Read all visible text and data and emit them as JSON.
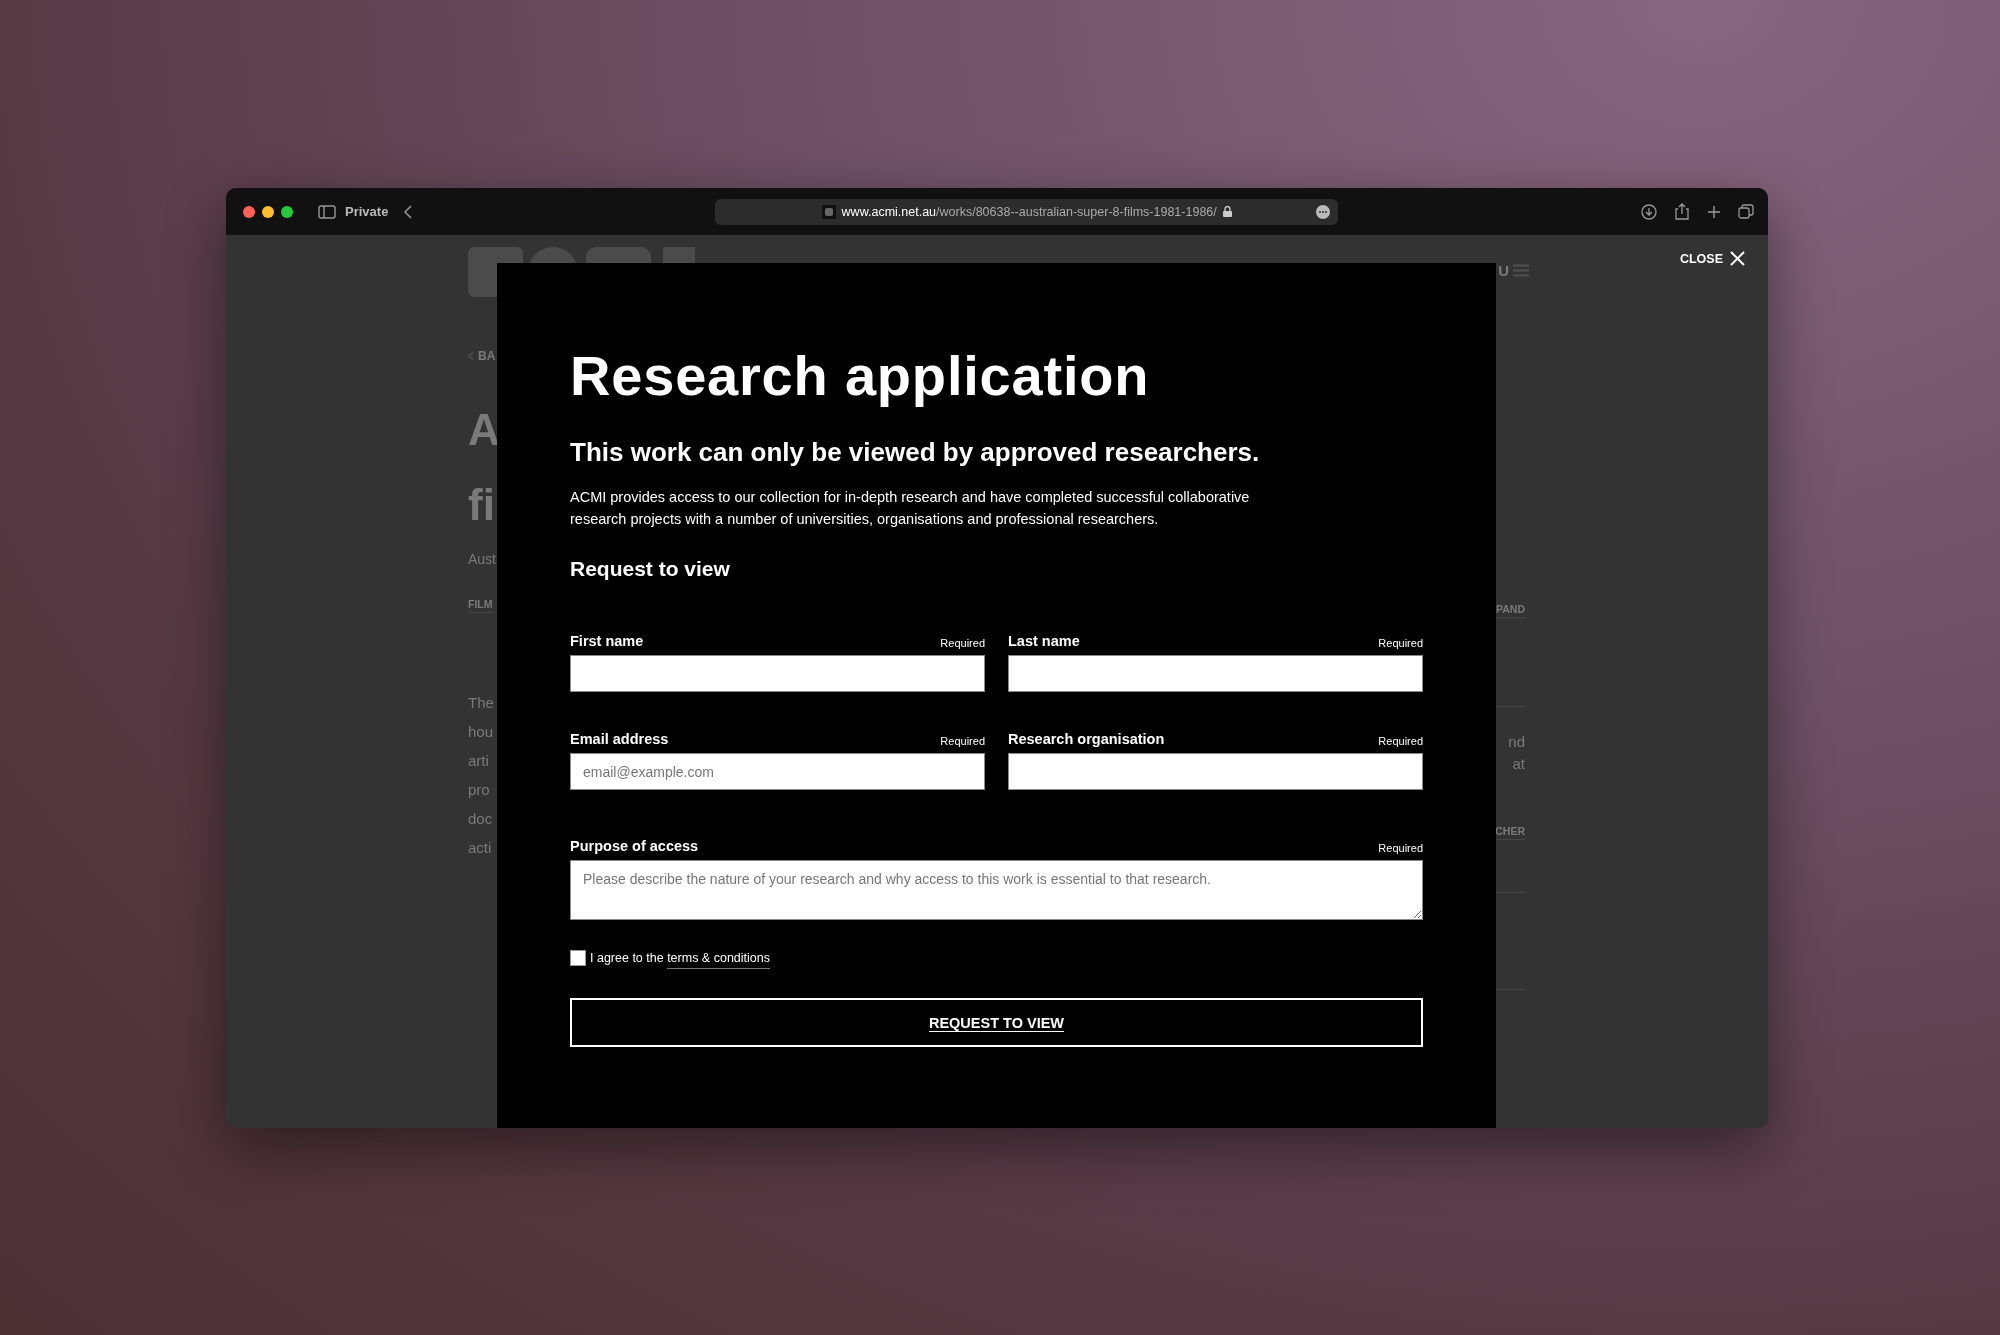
{
  "browser": {
    "mode_label": "Private",
    "url_host": "www.acmi.net.au",
    "url_path": "/works/80638--australian-super-8-films-1981-1986/"
  },
  "background_page": {
    "left_fragments": [
      {
        "kind": "back",
        "text": "BA"
      },
      {
        "kind": "title",
        "text": "A"
      },
      {
        "kind": "title",
        "text": "fi"
      },
      {
        "kind": "meta",
        "text": "Aust"
      },
      {
        "kind": "tag",
        "text": "FILM"
      },
      {
        "kind": "body",
        "text": "The"
      },
      {
        "kind": "body",
        "text": "hou"
      },
      {
        "kind": "body",
        "text": "arti"
      },
      {
        "kind": "body",
        "text": "pro"
      },
      {
        "kind": "body",
        "text": "doc"
      },
      {
        "kind": "body",
        "text": "acti"
      }
    ],
    "right_fragments": [
      {
        "kind": "menu",
        "text": "U"
      },
      {
        "kind": "tag",
        "text": "PAND"
      },
      {
        "kind": "rule"
      },
      {
        "kind": "body",
        "text": "nd"
      },
      {
        "kind": "body",
        "text": "at"
      },
      {
        "kind": "tag",
        "text": "CHER"
      },
      {
        "kind": "rule"
      },
      {
        "kind": "rule"
      }
    ]
  },
  "close_label": "CLOSE",
  "modal": {
    "title": "Research application",
    "subtitle": "This work can only be viewed by approved researchers.",
    "intro": "ACMI provides access to our collection for in-depth research and have completed successful collaborative research projects with a number of universities, organisations and professional researchers.",
    "section_heading": "Request to view",
    "fields": [
      {
        "kind": "text",
        "label": "First name",
        "note": "Required"
      },
      {
        "kind": "text",
        "label": "Last name",
        "note": "Required"
      },
      {
        "kind": "text",
        "label": "Email address",
        "note": "Required",
        "placeholder": "email@example.com"
      },
      {
        "kind": "text",
        "label": "Research organisation",
        "note": "Required"
      },
      {
        "kind": "textarea",
        "label": "Purpose of access",
        "note": "Required",
        "placeholder": "Please describe the nature of your research and why access to this work is essential to that research."
      }
    ],
    "agreement": {
      "text": "I agree to the",
      "link": "terms & conditions",
      "checked": false
    },
    "submit_label": "REQUEST TO VIEW"
  }
}
